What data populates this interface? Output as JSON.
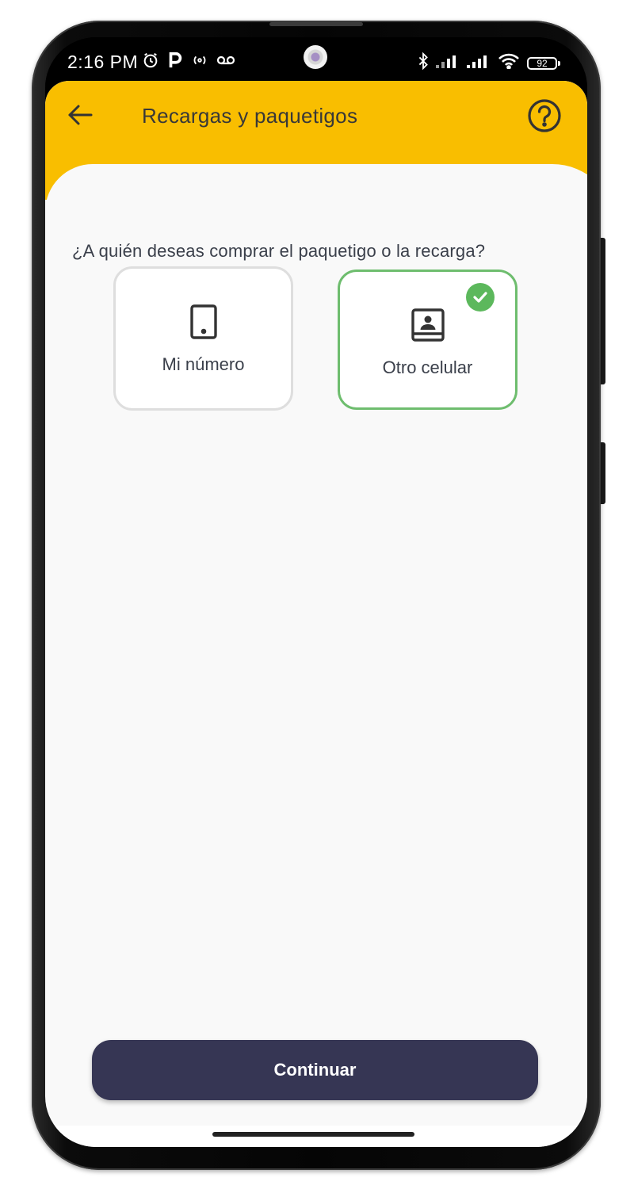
{
  "status_bar": {
    "time": "2:16 PM",
    "battery": "92",
    "icons_left": [
      "alarm-icon",
      "parking-p-icon",
      "hotspot-icon",
      "voicemail-icon"
    ],
    "icons_right": [
      "bluetooth-icon",
      "signal-icon",
      "signal-icon",
      "wifi-icon",
      "battery-icon"
    ]
  },
  "header": {
    "title": "Recargas y paquetigos",
    "back_icon": "arrow-left-icon",
    "help_icon": "help-circle-icon",
    "color": "#f9be00"
  },
  "main": {
    "question": "¿A quién deseas comprar el paquetigo o la recarga?",
    "options": [
      {
        "label": "Mi número",
        "icon": "smartphone-icon",
        "selected": false
      },
      {
        "label": "Otro celular",
        "icon": "contact-book-icon",
        "selected": true
      }
    ],
    "selected_color": "#6ebd6e"
  },
  "footer": {
    "continue_label": "Continuar",
    "button_color": "#363654"
  }
}
